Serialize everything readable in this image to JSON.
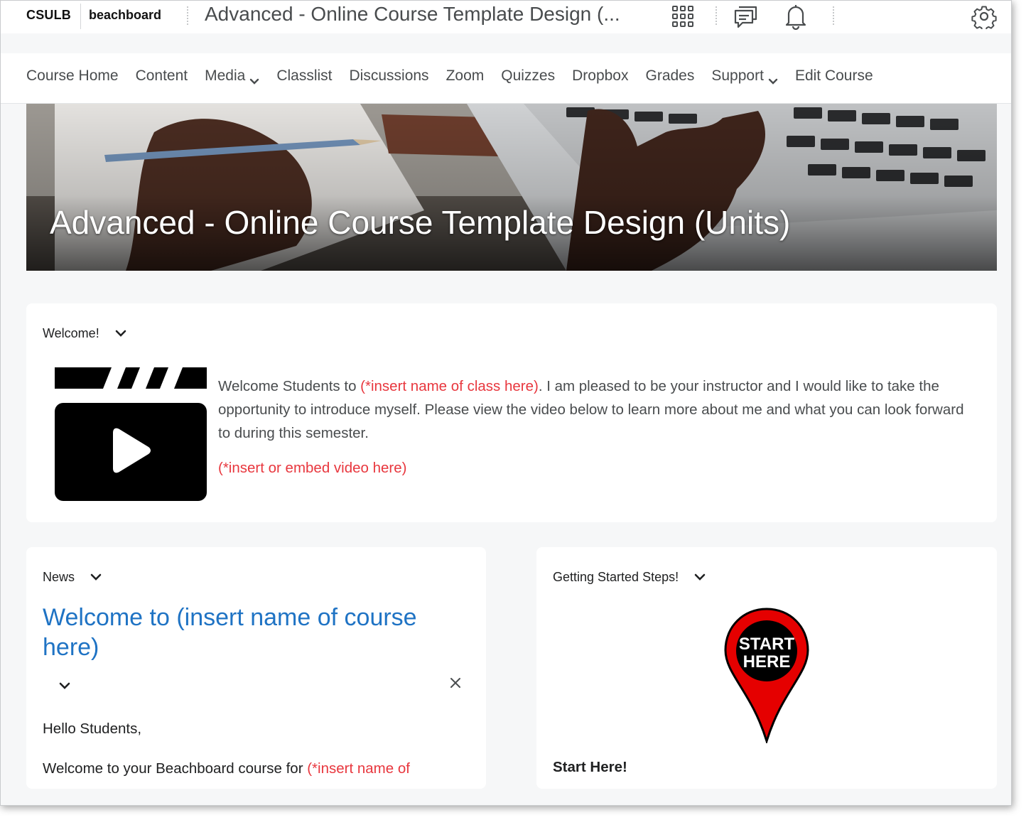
{
  "header": {
    "brand_org": "CSULB",
    "brand_app": "beachboard",
    "course_title": "Advanced - Online Course Template Design (...",
    "icons": [
      "waffle-grid-icon",
      "message-alerts-icon",
      "notification-bell-icon",
      "settings-gear-icon"
    ]
  },
  "nav": {
    "items": [
      {
        "label": "Course Home"
      },
      {
        "label": "Content"
      },
      {
        "label": "Media",
        "dropdown": true
      },
      {
        "label": "Classlist"
      },
      {
        "label": "Discussions"
      },
      {
        "label": "Zoom"
      },
      {
        "label": "Quizzes"
      },
      {
        "label": "Dropbox"
      },
      {
        "label": "Grades"
      },
      {
        "label": "Support",
        "dropdown": true
      },
      {
        "label": "Edit Course"
      }
    ]
  },
  "banner": {
    "title": "Advanced - Online Course Template Design (Units)"
  },
  "welcome": {
    "heading": "Welcome!",
    "intro_1": "Welcome Students to ",
    "intro_placeholder": "(*insert name of class here)",
    "intro_2": ".  I am pleased to be your instructor and I would like to take the opportunity to introduce myself.  Please view the video below to learn more about me and what you can look forward to during this semester.",
    "video_placeholder": "(*insert or embed video here)"
  },
  "news": {
    "heading": "News",
    "item_title": "Welcome to (insert name of course here)",
    "greeting": "Hello Students,",
    "body_1": "Welcome to your Beachboard course for ",
    "body_placeholder": "(*insert name of"
  },
  "steps": {
    "heading": "Getting Started Steps!",
    "pin_line1": "START",
    "pin_line2": "HERE",
    "link_label": "Start Here!"
  },
  "colors": {
    "link_blue": "#1f73c4",
    "placeholder_red": "#e8373e",
    "text": "#494c4e",
    "pin_red": "#e50000"
  }
}
